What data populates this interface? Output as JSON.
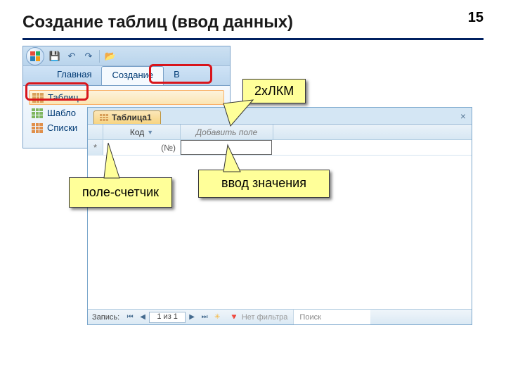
{
  "slide": {
    "title": "Создание таблиц (ввод данных)",
    "page_number": "15"
  },
  "ribbon": {
    "tabs": {
      "home": "Главная",
      "create": "Создание",
      "cut_off": "В"
    },
    "items": {
      "table": "Таблиц",
      "templates": "Шабло",
      "lists": "Списки"
    }
  },
  "datasheet": {
    "tab_title": "Таблица1",
    "columns": {
      "id": "Код",
      "add_field": "Добавить поле"
    },
    "new_row_placeholder": "(№)"
  },
  "status": {
    "record_label": "Запись:",
    "record_pos": "1 из 1",
    "no_filter": "Нет фильтра",
    "search": "Поиск"
  },
  "callouts": {
    "dblclick": "2хЛКМ",
    "counter_field": "поле-счетчик",
    "enter_value": "ввод значения"
  }
}
